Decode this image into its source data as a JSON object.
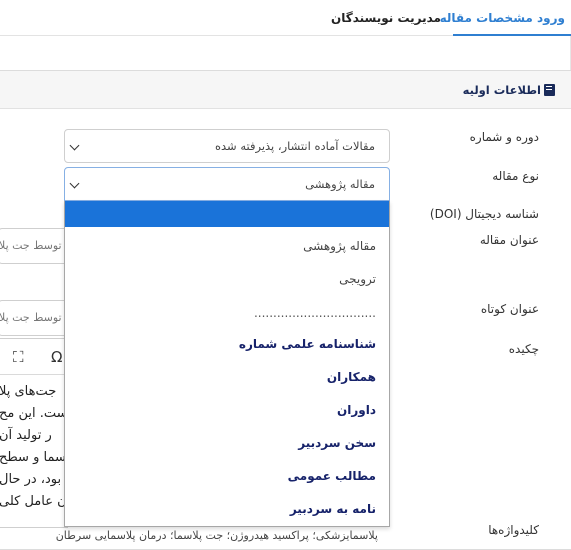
{
  "tabs": {
    "entry": "ورود مشخصات مقاله",
    "authors": "مدیریت نویسندگان"
  },
  "panel": {
    "title": "اطلاعات اولیه"
  },
  "form": {
    "issue_label": "دوره و شماره",
    "issue_value": "مقالات آماده انتشار، پذیرفته شده",
    "type_label": "نوع مقاله",
    "type_value": "مقاله پژوهشی",
    "doi_label": "شناسه دیجیتال (DOI)",
    "title_label": "عنوان مقاله",
    "title_placeholder": "ه توسط جت پلا",
    "short_title_label": "عنوان کوتاه",
    "short_title_placeholder": "ه توسط جت پلا",
    "abstract_label": "چکیده",
    "abstract_lines": [
      "جت‌های پلا",
      "ست. این مح",
      "ر تولید آن",
      "سما و سطح",
      "بود، در حال",
      "ن عامل کلی"
    ],
    "keywords_label": "کلیدواژه‌ها",
    "keywords_value": "پلاسمایزشکی؛ پراکسید هیدروژن؛ جت پلاسما؛ درمان پلاسمایی سرطان"
  },
  "dropdown": {
    "options": [
      "",
      "مقاله پژوهشی",
      "ترویجی",
      "................................",
      "شناسنامه علمی شماره",
      "همکاران",
      "داوران",
      "سخن سردبیر",
      "مطالب عمومی",
      "نامه به سردبیر"
    ],
    "selected_color": "#1a73d9",
    "link_color": "#16226a"
  },
  "icons": {
    "book": "book-icon",
    "chevron": "chevron-down-icon",
    "fullscreen": "fullscreen-icon",
    "omega": "special-chars-icon"
  }
}
